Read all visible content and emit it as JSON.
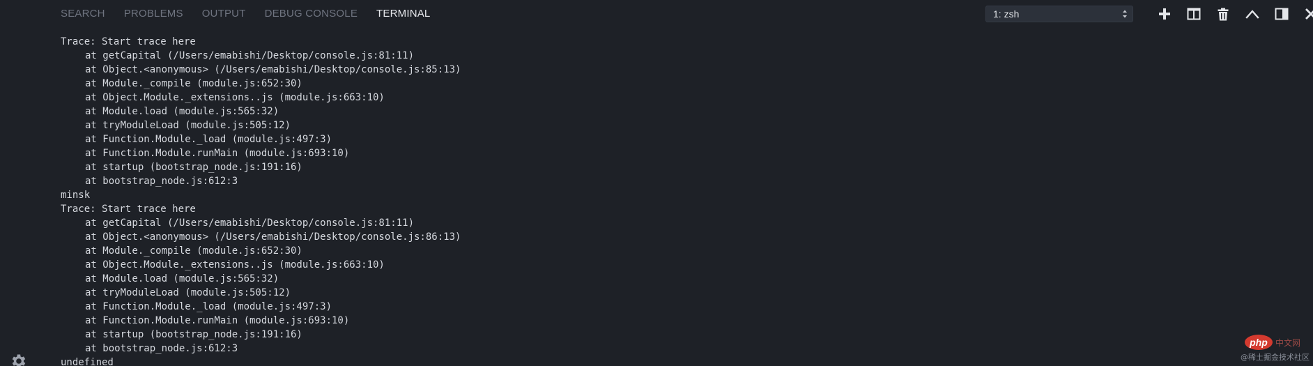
{
  "colors": {
    "background": "#1e2127",
    "tab_inactive": "#6f7480",
    "tab_active": "#e6e8ec",
    "terminal_text": "#d5d8de",
    "watermark_red": "#d43a2f"
  },
  "panel": {
    "tabs": [
      {
        "label": "SEARCH",
        "active": false
      },
      {
        "label": "PROBLEMS",
        "active": false
      },
      {
        "label": "OUTPUT",
        "active": false
      },
      {
        "label": "DEBUG CONSOLE",
        "active": false
      },
      {
        "label": "TERMINAL",
        "active": true
      }
    ],
    "terminal_select": {
      "value": "1: zsh",
      "icon": "updown-arrows-icon"
    },
    "actions": [
      {
        "name": "new-terminal",
        "icon": "plus-icon"
      },
      {
        "name": "split-terminal",
        "icon": "split-icon"
      },
      {
        "name": "kill-terminal",
        "icon": "trash-icon"
      },
      {
        "name": "maximize-panel",
        "icon": "chevron-up-icon"
      },
      {
        "name": "toggle-panel-position",
        "icon": "panel-right-icon"
      },
      {
        "name": "close-panel",
        "icon": "close-icon"
      }
    ]
  },
  "terminal": {
    "lines": [
      {
        "text": "Trace: Start trace here",
        "indent": false
      },
      {
        "text": "at getCapital (/Users/emabishi/Desktop/console.js:81:11)",
        "indent": true
      },
      {
        "text": "at Object.<anonymous> (/Users/emabishi/Desktop/console.js:85:13)",
        "indent": true
      },
      {
        "text": "at Module._compile (module.js:652:30)",
        "indent": true
      },
      {
        "text": "at Object.Module._extensions..js (module.js:663:10)",
        "indent": true
      },
      {
        "text": "at Module.load (module.js:565:32)",
        "indent": true
      },
      {
        "text": "at tryModuleLoad (module.js:505:12)",
        "indent": true
      },
      {
        "text": "at Function.Module._load (module.js:497:3)",
        "indent": true
      },
      {
        "text": "at Function.Module.runMain (module.js:693:10)",
        "indent": true
      },
      {
        "text": "at startup (bootstrap_node.js:191:16)",
        "indent": true
      },
      {
        "text": "at bootstrap_node.js:612:3",
        "indent": true
      },
      {
        "text": "minsk",
        "indent": false
      },
      {
        "text": "Trace: Start trace here",
        "indent": false
      },
      {
        "text": "at getCapital (/Users/emabishi/Desktop/console.js:81:11)",
        "indent": true
      },
      {
        "text": "at Object.<anonymous> (/Users/emabishi/Desktop/console.js:86:13)",
        "indent": true
      },
      {
        "text": "at Module._compile (module.js:652:30)",
        "indent": true
      },
      {
        "text": "at Object.Module._extensions..js (module.js:663:10)",
        "indent": true
      },
      {
        "text": "at Module.load (module.js:565:32)",
        "indent": true
      },
      {
        "text": "at tryModuleLoad (module.js:505:12)",
        "indent": true
      },
      {
        "text": "at Function.Module._load (module.js:497:3)",
        "indent": true
      },
      {
        "text": "at Function.Module.runMain (module.js:693:10)",
        "indent": true
      },
      {
        "text": "at startup (bootstrap_node.js:191:16)",
        "indent": true
      },
      {
        "text": "at bootstrap_node.js:612:3",
        "indent": true
      },
      {
        "text": "undefined",
        "indent": false
      }
    ]
  },
  "footer": {
    "settings_icon": "gear-icon"
  },
  "watermark": {
    "logo": "php",
    "site": "中文网",
    "caption": "@稀土掘金技术社区"
  }
}
